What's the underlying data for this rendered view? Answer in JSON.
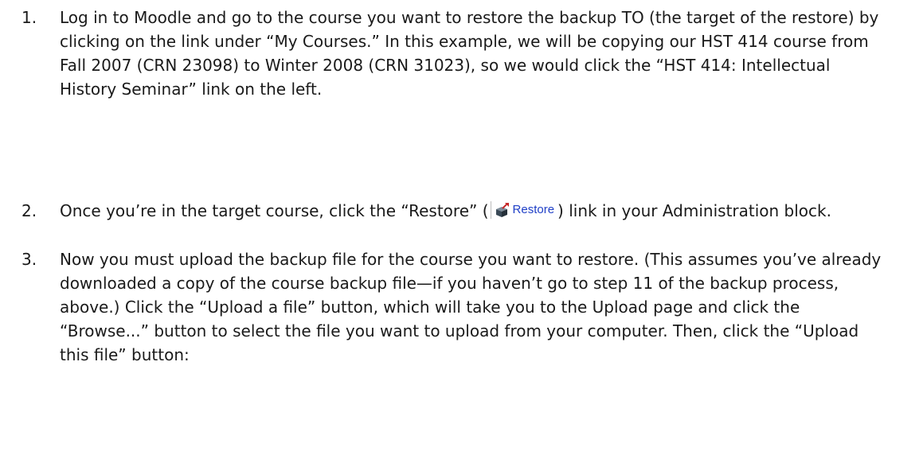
{
  "steps": [
    {
      "number": "1.",
      "text": "Log in to Moodle and go to the course you want to restore the backup TO (the target of the restore) by clicking on the link under “My Courses.”  In this example, we will be copying our HST 414 course from Fall 2007 (CRN 23098) to Winter 2008 (CRN 31023), so we would click the “HST 414: Intellectual History Seminar” link on the left."
    },
    {
      "number": "2.",
      "text_before": "Once you’re in the target course, click the “Restore” (",
      "restore_link_label": "Restore",
      "restore_icon": "restore-icon",
      "text_after": ") link in your Administration block."
    },
    {
      "number": "3.",
      "text": "Now you must upload the backup file for the course you want to restore.  (This assumes you’ve already downloaded a copy of the course backup file—if you haven’t go to step 11 of the backup process, above.)  Click the “Upload a file” button, which will take you to the Upload page and click the “Browse...” button to select the file you want to upload from your computer.  Then, click the “Upload this file” button:"
    }
  ],
  "colors": {
    "text": "#1a1a1a",
    "link": "#1f3fc7",
    "icon_box": "#3a4a57",
    "icon_arrow": "#c62828"
  }
}
